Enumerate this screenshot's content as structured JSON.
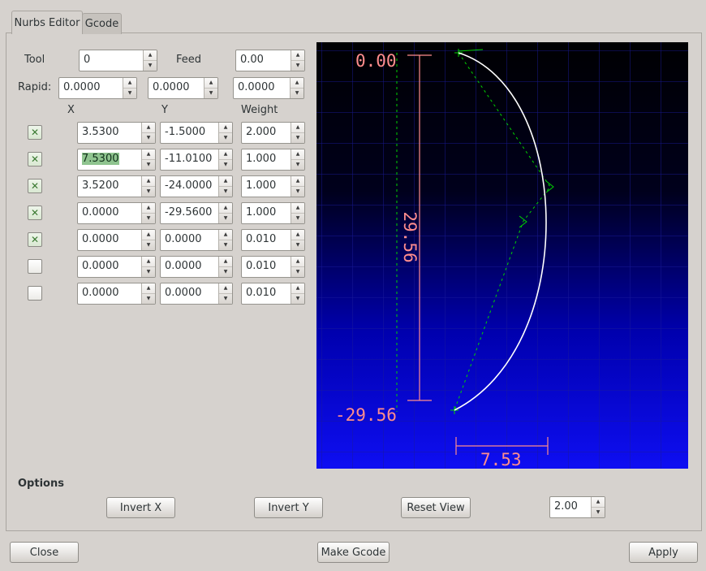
{
  "tabs": {
    "nurbs": "Nurbs Editor",
    "gcode": "Gcode"
  },
  "form": {
    "tool_label": "Tool",
    "tool_value": "0",
    "feed_label": "Feed",
    "feed_value": "0.00",
    "rapid_label": "Rapid:",
    "rapid": [
      "0.0000",
      "0.0000",
      "0.0000"
    ],
    "headers": {
      "x": "X",
      "y": "Y",
      "weight": "Weight"
    },
    "rows": [
      {
        "checked": true,
        "selected": false,
        "x": "3.5300",
        "y": "-1.5000",
        "weight": "2.000"
      },
      {
        "checked": true,
        "selected": true,
        "x": "7.5300",
        "y": "-11.0100",
        "weight": "1.000"
      },
      {
        "checked": true,
        "selected": false,
        "x": "3.5200",
        "y": "-24.0000",
        "weight": "1.000"
      },
      {
        "checked": true,
        "selected": false,
        "x": "0.0000",
        "y": "-29.5600",
        "weight": "1.000"
      },
      {
        "checked": true,
        "selected": false,
        "x": "0.0000",
        "y": "0.0000",
        "weight": "0.010"
      },
      {
        "checked": false,
        "selected": false,
        "x": "0.0000",
        "y": "0.0000",
        "weight": "0.010"
      },
      {
        "checked": false,
        "selected": false,
        "x": "0.0000",
        "y": "0.0000",
        "weight": "0.010"
      }
    ]
  },
  "plot": {
    "dim_top": "0.00",
    "dim_height": "29.56",
    "dim_bottom": "-29.56",
    "dim_width": "7.53",
    "colors": {
      "dimension": "#ff8d8d",
      "curve": "#ffffff",
      "control": "#00d400",
      "grid": "#1a1a9a"
    }
  },
  "options": {
    "label": "Options",
    "invert_x": "Invert X",
    "invert_y": "Invert Y",
    "reset_view": "Reset View",
    "scale": "2.00"
  },
  "footer": {
    "close": "Close",
    "make_gcode": "Make Gcode",
    "apply": "Apply"
  }
}
